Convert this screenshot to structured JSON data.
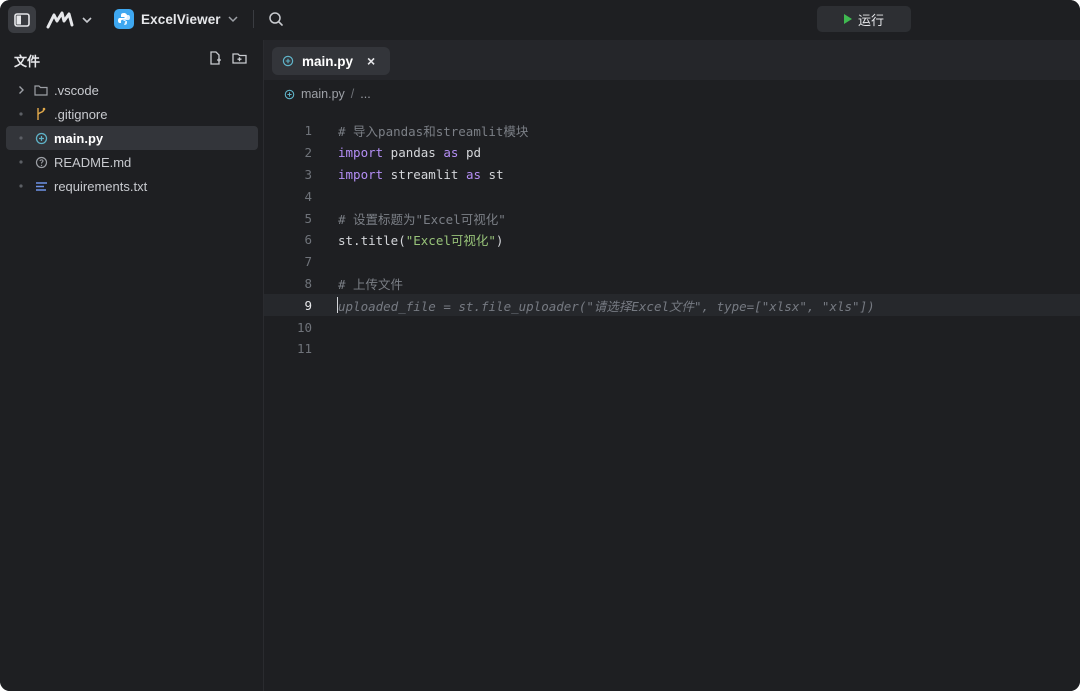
{
  "topbar": {
    "project_name": "ExcelViewer",
    "run_label": "运行"
  },
  "sidebar": {
    "header": "文件",
    "files": [
      {
        "name": ".vscode",
        "icon": "folder-icon",
        "kind": "folder"
      },
      {
        "name": ".gitignore",
        "icon": "git-branch-icon",
        "kind": "file"
      },
      {
        "name": "main.py",
        "icon": "python-file-icon",
        "kind": "file",
        "active": true
      },
      {
        "name": "README.md",
        "icon": "help-circle-icon",
        "kind": "file"
      },
      {
        "name": "requirements.txt",
        "icon": "text-lines-icon",
        "kind": "file"
      }
    ]
  },
  "editor": {
    "tab_label": "main.py",
    "tab_close": "×",
    "breadcrumb": {
      "file": "main.py",
      "sep": "/",
      "more": "..."
    },
    "current_line": 9,
    "lines": {
      "n1": "1",
      "n2": "2",
      "n3": "3",
      "n4": "4",
      "n5": "5",
      "n6": "6",
      "n7": "7",
      "n8": "8",
      "n9": "9",
      "n10": "10",
      "n11": "11",
      "l1": "# 导入pandas和streamlit模块",
      "l2_kw1": "import",
      "l2_mid": " pandas ",
      "l2_kw2": "as",
      "l2_end": " pd",
      "l3_kw1": "import",
      "l3_mid": " streamlit ",
      "l3_kw2": "as",
      "l3_end": " st",
      "l5": "# 设置标题为\"Excel可视化\"",
      "l6_pre": "st.title(",
      "l6_str": "\"Excel可视化\"",
      "l6_post": ")",
      "l8": "# 上传文件",
      "l9": "uploaded_file = st.file_uploader(\"请选择Excel文件\", type=[\"xlsx\", \"xls\"])"
    }
  },
  "colors": {
    "background": "#1e1f22",
    "accent": "#3b82f6",
    "keyword": "#b48ef5",
    "string": "#98c379",
    "run_icon": "#3fb950",
    "project_badge": "#3ea7f0"
  }
}
